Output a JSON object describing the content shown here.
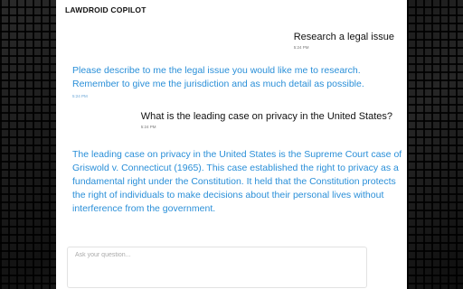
{
  "app": {
    "title": "LAWDROID COPILOT"
  },
  "messages": [
    {
      "role": "user",
      "text": "Research a legal issue",
      "time": "5:24 PM"
    },
    {
      "role": "assistant",
      "text": "Please describe to me the legal issue you would like me to research. Remember to give me the jurisdiction and as much detail as possible.",
      "time": "5:24 PM"
    },
    {
      "role": "user",
      "text": "What is the leading case on privacy in the United States?",
      "time": "5:24 PM"
    },
    {
      "role": "assistant",
      "text": "The leading case on privacy in the United States is the Supreme Court case of Griswold v. Connecticut (1965). This case established the right to privacy as a fundamental right under the Constitution. It held that the Constitution protects the right of individuals to make decisions about their personal lives without interference from the government."
    }
  ],
  "composer": {
    "placeholder": "Ask your question...",
    "value": ""
  },
  "colors": {
    "assistant_text": "#2a8fd8",
    "user_text": "#111111",
    "background": "#ffffff"
  }
}
